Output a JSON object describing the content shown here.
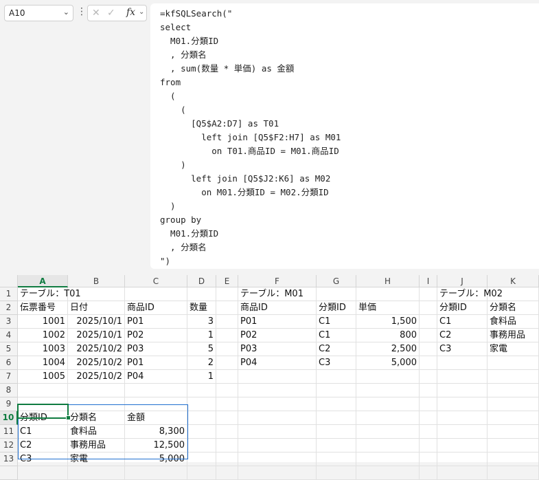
{
  "namebox": {
    "value": "A10"
  },
  "formula_bar": {
    "text": "=kfSQLSearch(\"\nselect\n  M01.分類ID\n  , 分類名\n  , sum(数量 * 単価) as 金額\nfrom\n  (\n    (\n      [Q5$A2:D7] as T01\n        left join [Q5$F2:H7] as M01\n          on T01.商品ID = M01.商品ID\n    )\n      left join [Q5$J2:K6] as M02\n        on M01.分類ID = M02.分類ID\n  )\ngroup by\n  M01.分類ID\n  , 分類名\n\")"
  },
  "columns": [
    "A",
    "B",
    "C",
    "D",
    "E",
    "F",
    "G",
    "H",
    "I",
    "J",
    "K"
  ],
  "rows": [
    "1",
    "2",
    "3",
    "4",
    "5",
    "6",
    "7",
    "8",
    "9",
    "10",
    "11",
    "12",
    "13",
    ""
  ],
  "cells": {
    "r1": {
      "A": "テーブル：T01",
      "F": "テーブル：M01",
      "J": "テーブル：M02"
    },
    "r2": {
      "A": "伝票番号",
      "B": "日付",
      "C": "商品ID",
      "D": "数量",
      "F": "商品ID",
      "G": "分類ID",
      "H": "単価",
      "J": "分類ID",
      "K": "分類名"
    },
    "r3": {
      "A": "1001",
      "B": "2025/10/1",
      "C": "P01",
      "D": "3",
      "F": "P01",
      "G": "C1",
      "H": "1,500",
      "J": "C1",
      "K": "食料品"
    },
    "r4": {
      "A": "1002",
      "B": "2025/10/1",
      "C": "P02",
      "D": "1",
      "F": "P02",
      "G": "C1",
      "H": "800",
      "J": "C2",
      "K": "事務用品"
    },
    "r5": {
      "A": "1003",
      "B": "2025/10/2",
      "C": "P03",
      "D": "5",
      "F": "P03",
      "G": "C2",
      "H": "2,500",
      "J": "C3",
      "K": "家電"
    },
    "r6": {
      "A": "1004",
      "B": "2025/10/2",
      "C": "P01",
      "D": "2",
      "F": "P04",
      "G": "C3",
      "H": "5,000"
    },
    "r7": {
      "A": "1005",
      "B": "2025/10/2",
      "C": "P04",
      "D": "1"
    },
    "r10": {
      "A": "分類ID",
      "B": "分類名",
      "C": "金額"
    },
    "r11": {
      "A": "C1",
      "B": "食料品",
      "C": "8,300"
    },
    "r12": {
      "A": "C2",
      "B": "事務用品",
      "C": "12,500"
    },
    "r13": {
      "A": "C3",
      "B": "家電",
      "C": "5,000"
    }
  },
  "selection": {
    "active_cell": "A10",
    "range": "A10:C13"
  },
  "colors": {
    "accent": "#107c41",
    "selection": "#1f6fd0"
  }
}
